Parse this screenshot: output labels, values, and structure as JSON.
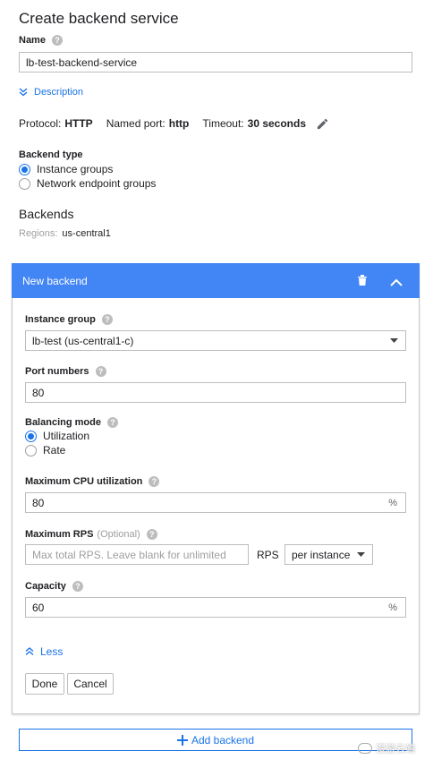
{
  "page": {
    "title": "Create backend service"
  },
  "name_field": {
    "label": "Name",
    "value": "lb-test-backend-service"
  },
  "description_toggle": "Description",
  "summary": {
    "protocol_label": "Protocol:",
    "protocol_value": "HTTP",
    "port_label": "Named port:",
    "port_value": "http",
    "timeout_label": "Timeout:",
    "timeout_value": "30 seconds"
  },
  "backend_type": {
    "label": "Backend type",
    "options": [
      "Instance groups",
      "Network endpoint groups"
    ],
    "selected": "Instance groups"
  },
  "backends": {
    "heading": "Backends",
    "regions_label": "Regions:",
    "regions_value": "us-central1"
  },
  "new_backend": {
    "header": "New backend",
    "instance_group": {
      "label": "Instance group",
      "value": "lb-test (us-central1-c)"
    },
    "port_numbers": {
      "label": "Port numbers",
      "value": "80"
    },
    "balancing_mode": {
      "label": "Balancing mode",
      "options": [
        "Utilization",
        "Rate"
      ],
      "selected": "Utilization"
    },
    "max_cpu": {
      "label": "Maximum CPU utilization",
      "value": "80",
      "unit": "%"
    },
    "max_rps": {
      "label": "Maximum RPS",
      "optional": "(Optional)",
      "placeholder": "Max total RPS. Leave blank for unlimited",
      "unit": "RPS",
      "scope": "per instance"
    },
    "capacity": {
      "label": "Capacity",
      "value": "60",
      "unit": "%"
    },
    "less_toggle": "Less",
    "done_label": "Done",
    "cancel_label": "Cancel"
  },
  "add_backend_label": "Add backend",
  "watermark": "漫游云端",
  "colors": {
    "accent": "#4285f4",
    "link": "#1a73e8"
  }
}
